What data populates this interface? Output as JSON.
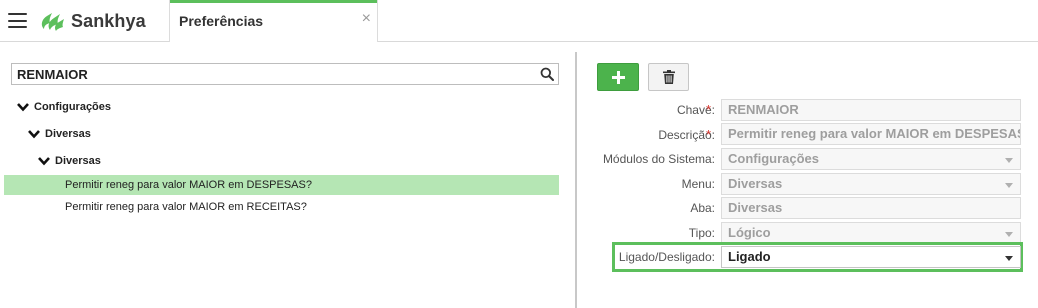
{
  "header": {
    "brand": "Sankhya",
    "tab_title": "Preferências",
    "close_symbol": "×"
  },
  "search": {
    "value": "RENMAIOR"
  },
  "tree": {
    "root": "Configurações",
    "level1": "Diversas",
    "level2": "Diversas",
    "items": [
      {
        "label": "Permitir reneg para valor MAIOR em DESPESAS?",
        "selected": true
      },
      {
        "label": "Permitir reneg para valor MAIOR em RECEITAS?",
        "selected": false
      }
    ]
  },
  "toolbar": {
    "add_icon": "plus-icon",
    "delete_icon": "trash-icon"
  },
  "form": {
    "chave": {
      "label": "Chave:",
      "required": "*",
      "value": "RENMAIOR"
    },
    "descricao": {
      "label": "Descrição:",
      "required": "*",
      "value": "Permitir reneg para valor MAIOR em DESPESAS"
    },
    "modulos": {
      "label": "Módulos do Sistema:",
      "value": "Configurações"
    },
    "menu": {
      "label": "Menu:",
      "value": "Diversas"
    },
    "aba": {
      "label": "Aba:",
      "value": "Diversas"
    },
    "tipo": {
      "label": "Tipo:",
      "value": "Lógico"
    },
    "ligado": {
      "label": "Ligado/Desligado:",
      "value": "Ligado"
    }
  },
  "colors": {
    "accent_green": "#5cbf5c",
    "selected_row": "#b5e6b4",
    "required_red": "#d9312b"
  }
}
